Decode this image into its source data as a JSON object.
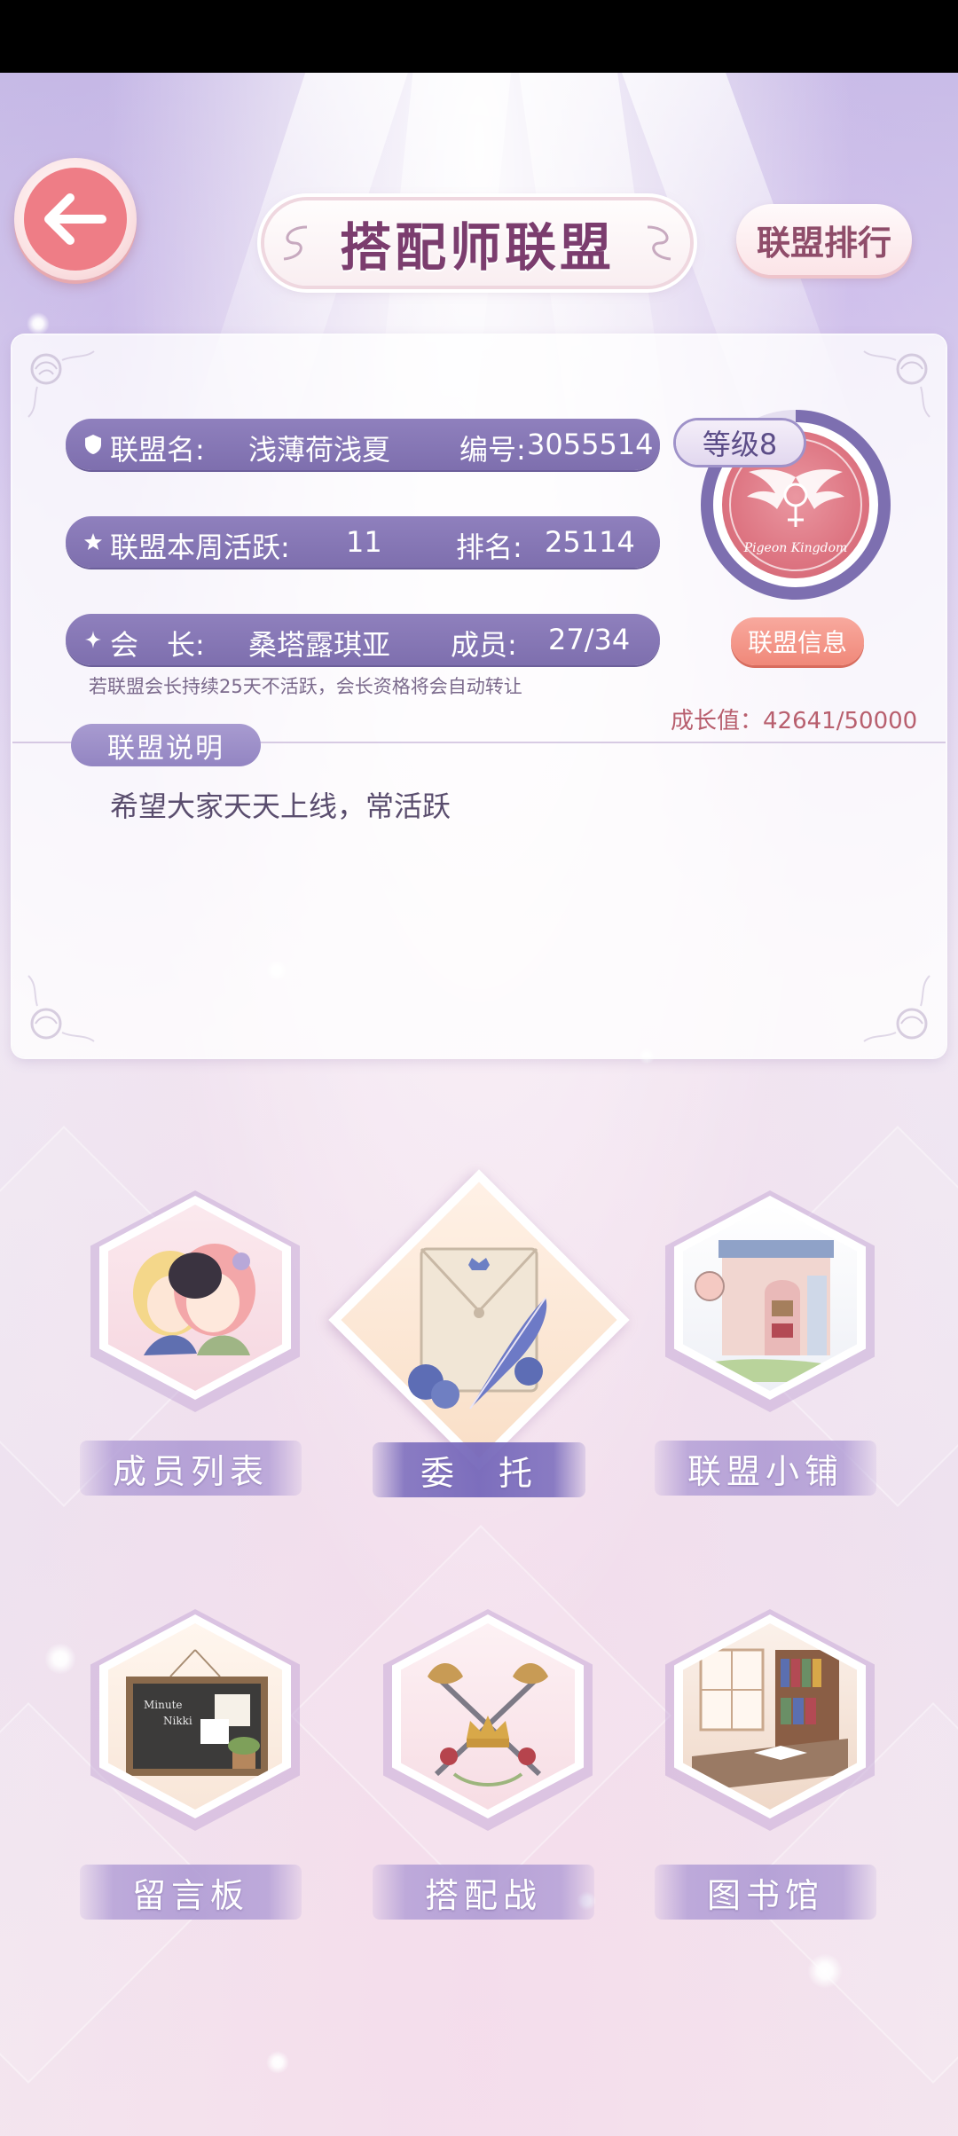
{
  "header": {
    "title": "搭配师联盟",
    "rank_button": "联盟排行"
  },
  "alliance": {
    "name_label": "联盟名:",
    "name_value": "浅薄荷浅夏",
    "id_label": "编号:",
    "id_value": "3055514",
    "activity_label": "联盟本周活跃:",
    "activity_value": "11",
    "rank_label": "排名:",
    "rank_value": "25114",
    "leader_label": "会　长:",
    "leader_value": "桑塔露琪亚",
    "members_label": "成员:",
    "members_value": "27/34",
    "level": "等级8",
    "emblem_text": "Pigeon Kingdom",
    "info_button": "联盟信息",
    "leader_hint": "若联盟会长持续25天不活跃，会长资格将会自动转让",
    "growth_label": "成长值：",
    "growth_value": "42641/50000",
    "growth_progress": 0.853
  },
  "description": {
    "tab": "联盟说明",
    "text": "希望大家天天上线，常活跃"
  },
  "features": [
    {
      "label": "成员列表",
      "icon": "members-icon"
    },
    {
      "label": "委　托",
      "icon": "commission-letter-icon"
    },
    {
      "label": "联盟小铺",
      "icon": "shop-icon"
    },
    {
      "label": "留言板",
      "icon": "message-board-icon"
    },
    {
      "label": "搭配战",
      "icon": "battle-crest-icon"
    },
    {
      "label": "图书馆",
      "icon": "library-icon"
    }
  ],
  "colors": {
    "accent_purple": "#7e6fae",
    "back_button_red": "#ee7d86",
    "growth_text": "#b85f6e",
    "title_text": "#7b3d6e"
  },
  "icons": {
    "back": "back-arrow-icon",
    "pill_1": "shield-icon",
    "pill_2": "star-icon",
    "pill_3": "sparkle-icon"
  }
}
